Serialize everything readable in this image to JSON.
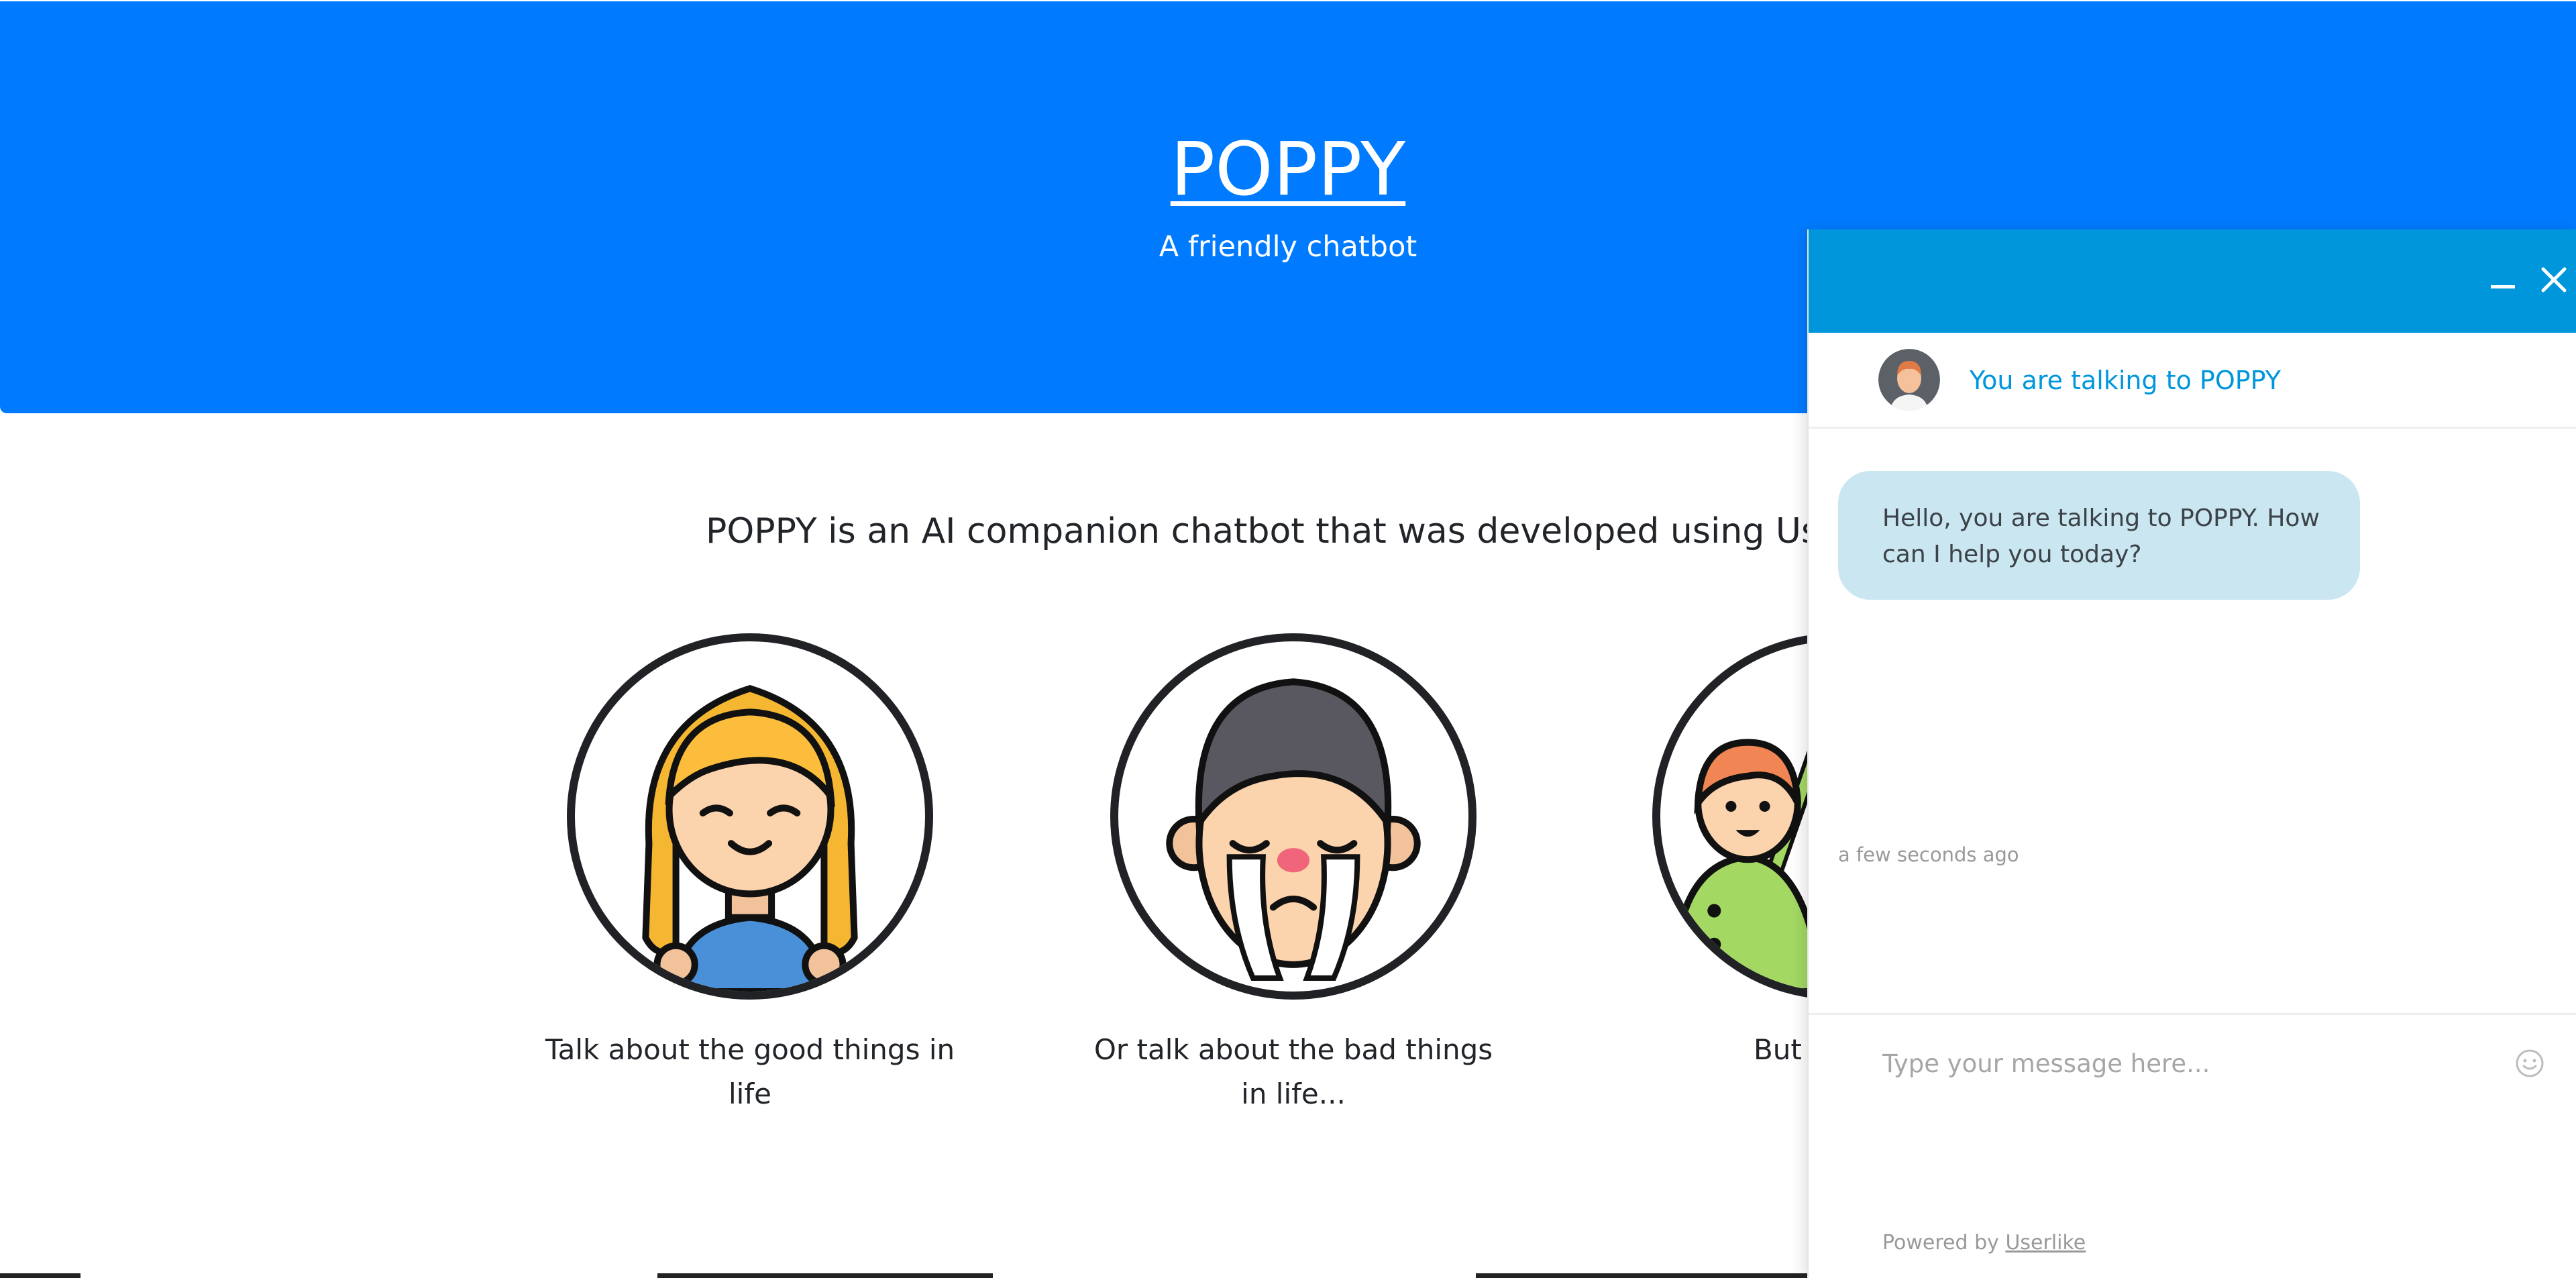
{
  "hero": {
    "title": "POPPY",
    "subtitle": "A friendly chatbot",
    "background": "#007bff"
  },
  "intro": {
    "text": "POPPY is an AI companion chatbot that was developed using User"
  },
  "features": [
    {
      "caption_line1": "Talk about the good things in",
      "caption_line2": "life",
      "icon": "smiling-girl-icon"
    },
    {
      "caption_line1": "Or talk about the bad things",
      "caption_line2": "in life...",
      "icon": "crying-boy-icon"
    },
    {
      "caption_line1": "But POPPY i",
      "caption_line2": "",
      "icon": "waving-people-icon"
    }
  ],
  "chat": {
    "accent": "#0096dc",
    "minimize_icon": "minimize-icon",
    "close_icon": "close-icon",
    "header_label": "You are talking to POPPY",
    "avatar_icon": "agent-avatar-icon",
    "message": "Hello, you are talking to POPPY. How can I help you today?",
    "message_time": "a few seconds ago",
    "input_placeholder": "Type your message here...",
    "emoji_icon": "smiley-icon",
    "footer_prefix": "Powered by",
    "footer_link": "Userlike",
    "bubble_color": "#c9e6f1"
  }
}
